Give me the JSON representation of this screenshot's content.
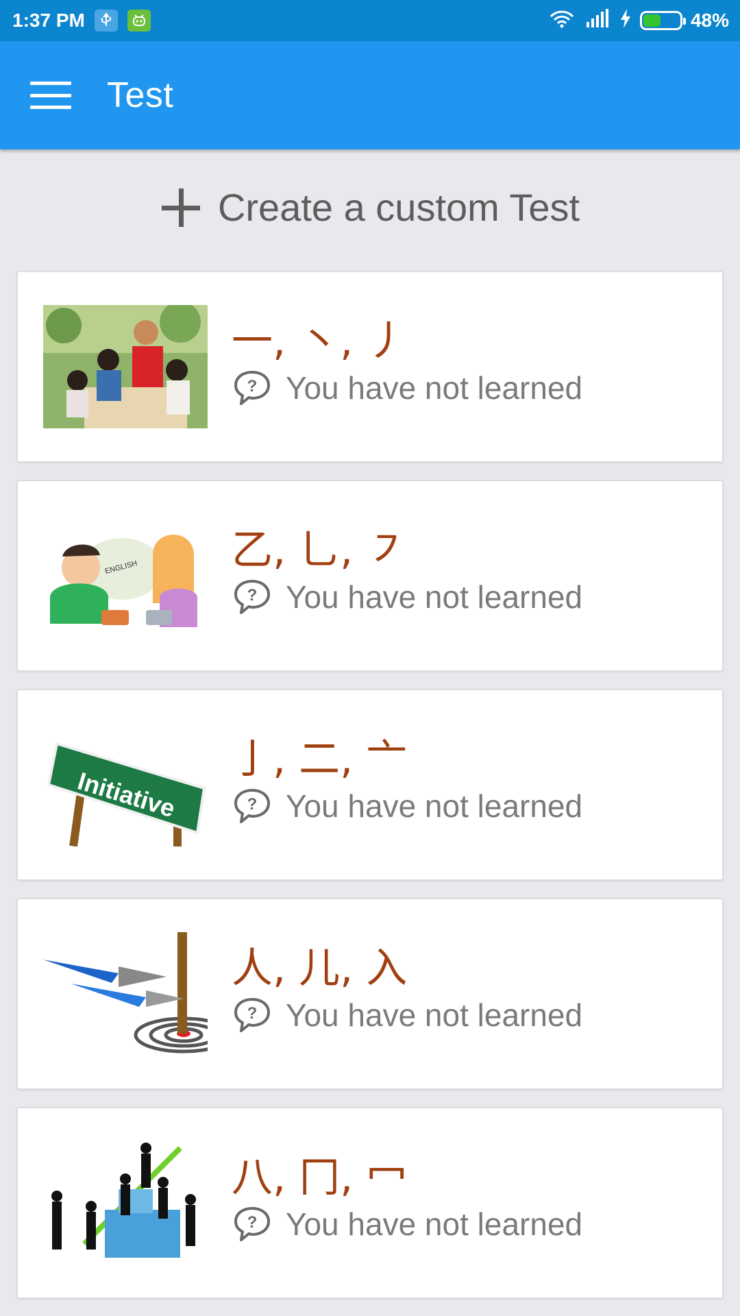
{
  "status_bar": {
    "time": "1:37 PM",
    "battery": "48%",
    "battery_level": 0.48,
    "icons": [
      "usb-icon",
      "android-icon",
      "wifi-icon",
      "signal-icon",
      "charging-icon",
      "battery-icon"
    ]
  },
  "app_bar": {
    "title": "Test",
    "menu_icon": "hamburger-menu-icon",
    "color": "#2196f0"
  },
  "create": {
    "label": "Create a custom Test",
    "icon": "plus-icon"
  },
  "cards": [
    {
      "title": "一, 丶, 丿",
      "status": "You have not learned",
      "image": "children-learning"
    },
    {
      "title": "乙, 乚, ㇇",
      "status": "You have not learned",
      "image": "phone-conversation"
    },
    {
      "title": "亅, 二, 亠",
      "status": "You have not learned",
      "image": "initiative-sign"
    },
    {
      "title": "人, 儿, 入",
      "status": "You have not learned",
      "image": "dart-target"
    },
    {
      "title": "八, 冂, 冖",
      "status": "You have not learned",
      "image": "business-people"
    }
  ],
  "colors": {
    "status_bar": "#0c85cf",
    "title_text": "#a04010",
    "status_text": "#7a7a7a",
    "background": "#e9e9ed"
  }
}
